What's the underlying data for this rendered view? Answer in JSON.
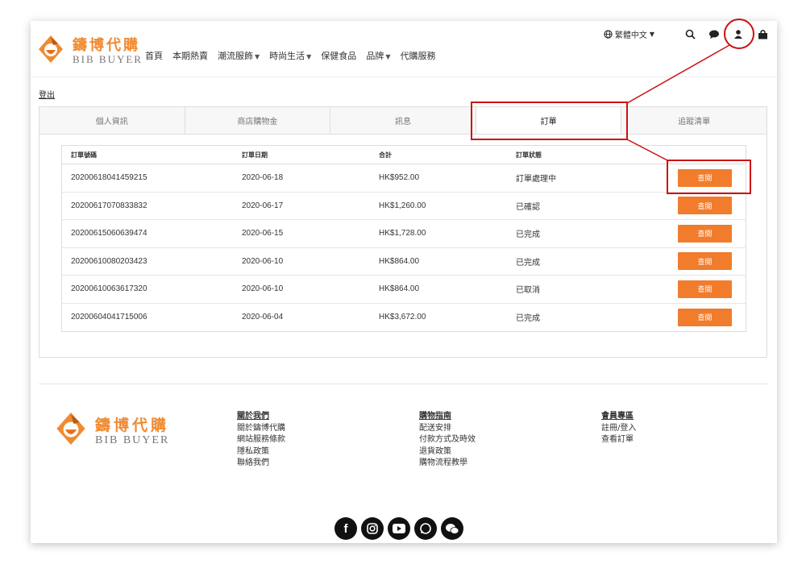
{
  "brand": {
    "name_cn": "鑄博代購",
    "name_en": "BIB BUYER"
  },
  "nav": [
    {
      "label": "首頁",
      "has_dropdown": false
    },
    {
      "label": "本期熱賣",
      "has_dropdown": false
    },
    {
      "label": "潮流服飾",
      "has_dropdown": true
    },
    {
      "label": "時尚生活",
      "has_dropdown": true
    },
    {
      "label": "保健食品",
      "has_dropdown": false
    },
    {
      "label": "品牌",
      "has_dropdown": true
    },
    {
      "label": "代購服務",
      "has_dropdown": false
    }
  ],
  "top_right": {
    "language": "繁體中文",
    "icons": [
      "globe-icon",
      "search-icon",
      "chat-icon",
      "user-icon",
      "bag-icon"
    ]
  },
  "account": {
    "logout": "登出",
    "tabs": [
      "個人資訊",
      "商店購物金",
      "訊息",
      "訂單",
      "追蹤清單"
    ],
    "active_tab": "訂單"
  },
  "orders": {
    "headers": [
      "訂單號碼",
      "訂單日期",
      "合計",
      "訂單狀態"
    ],
    "view_label": "查閱",
    "rows": [
      {
        "id": "20200618041459215",
        "date": "2020-06-18",
        "total": "HK$952.00",
        "status": "訂單處理中"
      },
      {
        "id": "20200617070833832",
        "date": "2020-06-17",
        "total": "HK$1,260.00",
        "status": "已確認"
      },
      {
        "id": "20200615060639474",
        "date": "2020-06-15",
        "total": "HK$1,728.00",
        "status": "已完成"
      },
      {
        "id": "20200610080203423",
        "date": "2020-06-10",
        "total": "HK$864.00",
        "status": "已完成"
      },
      {
        "id": "20200610063617320",
        "date": "2020-06-10",
        "total": "HK$864.00",
        "status": "已取消"
      },
      {
        "id": "20200604041715006",
        "date": "2020-06-04",
        "total": "HK$3,672.00",
        "status": "已完成"
      }
    ]
  },
  "footer": {
    "columns": [
      {
        "title": "關於我們",
        "links": [
          "關於鑄博代購",
          "網站服務條款",
          "隱私政策",
          "聯絡我們"
        ]
      },
      {
        "title": "購物指南",
        "links": [
          "配送安排",
          "付款方式及時效",
          "退貨政策",
          "購物流程教學"
        ]
      },
      {
        "title": "會員專區",
        "links": [
          "註冊/登入",
          "查看訂單"
        ]
      }
    ],
    "social": [
      "facebook-icon",
      "instagram-icon",
      "youtube-icon",
      "whatsapp-icon",
      "wechat-icon"
    ]
  },
  "colors": {
    "accent": "#f07c2c",
    "brand": "#f08a30",
    "annotation": "#cc1111"
  }
}
